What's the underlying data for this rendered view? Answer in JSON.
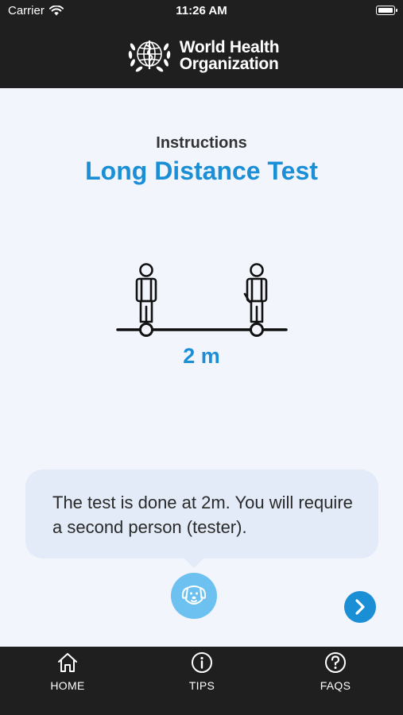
{
  "status": {
    "carrier": "Carrier",
    "time": "11:26 AM",
    "battery_level": 1.0
  },
  "header": {
    "logo_line1": "World Health",
    "logo_line2": "Organization",
    "logo_icon": "who-emblem-icon"
  },
  "main": {
    "instructions_label": "Instructions",
    "title": "Long Distance Test",
    "distance": "2 m",
    "bubble_text": "The test is done at 2m. You will require a second person (tester).",
    "mascot_icon": "dog-face-icon",
    "next_icon": "chevron-right-icon"
  },
  "tabbar": {
    "items": [
      {
        "label": "HOME",
        "icon": "home-icon"
      },
      {
        "label": "TIPS",
        "icon": "info-icon"
      },
      {
        "label": "FAQS",
        "icon": "question-icon"
      }
    ]
  },
  "colors": {
    "accent": "#1a8fd6",
    "bar": "#1f1f1f",
    "background": "#f3f5fd",
    "bubble": "#e2ebf7",
    "mascot": "#6cc1f0"
  }
}
